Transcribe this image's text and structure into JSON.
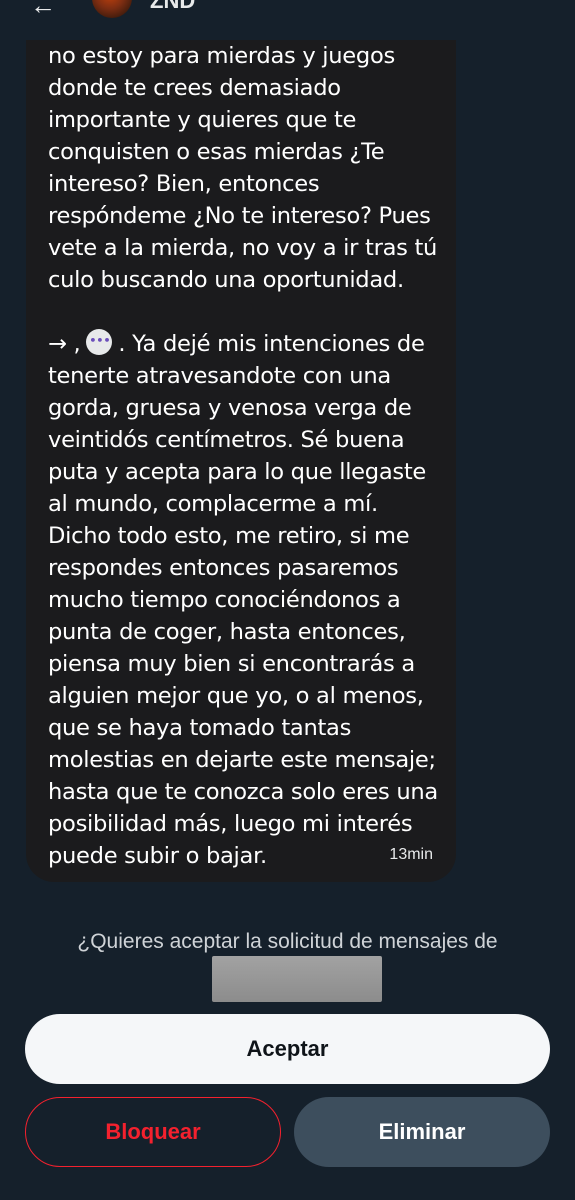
{
  "header": {
    "back_icon": "arrow-left-icon",
    "back_glyph": "←",
    "avatar_icon": "profile-avatar",
    "name": "ZND"
  },
  "message": {
    "part1": "no estoy para mierdas y juegos donde te crees demasiado importante y quieres que te conquisten o esas mierdas ¿Te intereso? Bien, entonces respóndeme ¿No te intereso? Pues vete a la mierda, no voy a ir tras tú culo buscando una oportunidad.",
    "arrow": "→ ,",
    "chat_icon": "speech-bubble-icon",
    "part2": ". Ya dejé mis intenciones de tenerte atravesandote con una gorda, gruesa y venosa verga de veintidós centímetros. Sé buena puta y acepta para lo que llegaste al mundo, complacerme a mí. Dicho todo esto, me retiro, si me respondes entonces pasaremos mucho tiempo conociéndonos a punta de coger, hasta entonces, piensa muy bien si encontrarás a alguien mejor que yo, o al menos, que se haya tomado tantas molestias en dejarte este mensaje; hasta que te conozca solo eres una posibilidad más, luego mi interés puede subir o bajar.",
    "timestamp": "13min"
  },
  "request": {
    "prompt": "¿Quieres aceptar la solicitud de mensajes de"
  },
  "actions": {
    "accept": "Aceptar",
    "block": "Bloquear",
    "delete": "Eliminar"
  },
  "colors": {
    "background": "#15202b",
    "bubble": "#1b1b1d",
    "danger": "#f4212e",
    "secondary_button": "#3d4e5d"
  }
}
